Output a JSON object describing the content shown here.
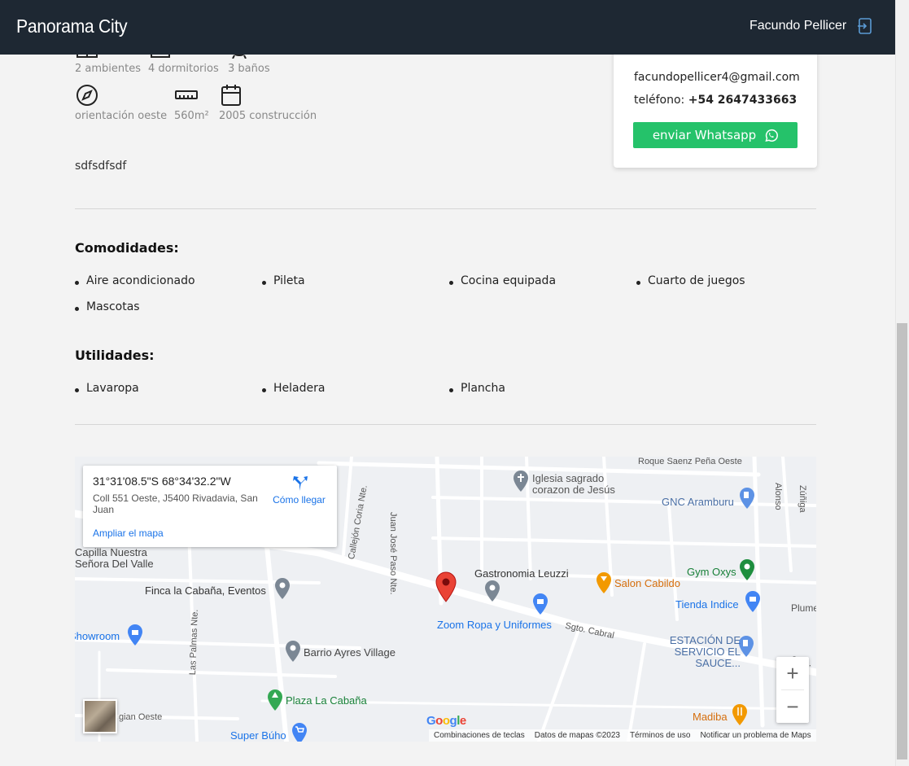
{
  "header": {
    "brand": "Panorama City",
    "user_name": "Facundo Pellicer"
  },
  "features": [
    {
      "icon": "rooms-icon",
      "label": "2 ambientes"
    },
    {
      "icon": "bed-icon",
      "label": "4 dormitorios"
    },
    {
      "icon": "bath-icon",
      "label": "3 baños"
    },
    {
      "icon": "compass-icon",
      "label": "orientación oeste"
    },
    {
      "icon": "ruler-icon",
      "label": "560m²"
    },
    {
      "icon": "calendar-icon",
      "label": "2005 construcción"
    }
  ],
  "description": "sdfsdfsdf",
  "contact": {
    "email": "facundopellicer4@gmail.com",
    "phone_label": "teléfono:",
    "phone": "+54 2647433663",
    "whatsapp_button": "enviar Whatsapp"
  },
  "amenities": {
    "title": "Comodidades:",
    "items": [
      "Aire acondicionado",
      "Pileta",
      "Cocina equipada",
      "Cuarto de juegos",
      "Mascotas"
    ]
  },
  "utilities": {
    "title": "Utilidades:",
    "items": [
      "Lavaropa",
      "Heladera",
      "Plancha"
    ]
  },
  "map": {
    "info": {
      "coords": "31°31'08.5\"S 68°34'32.2\"W",
      "address": "Coll 551 Oeste, J5400 Rivadavia, San Juan",
      "directions": "Cómo llegar",
      "expand": "Ampliar el mapa"
    },
    "places": {
      "iglesia": "Iglesia sagrado corazon de Jesús",
      "gnc": "GNC Aramburu",
      "gastronomia": "Gastronomia Leuzzi",
      "gym": "Gym Oxys",
      "salon": "Salon Cabildo",
      "tienda": "Tienda Indice",
      "zoom_ropa": "Zoom Ropa y Uniformes",
      "estacion": "ESTACIÓN DE SERVICIO EL SAUCE...",
      "finca": "Finca la Cabaña, Eventos",
      "capilla": "Capilla Nuestra Señora Del Valle",
      "showroom": "Showroom",
      "barrio": "Barrio Ayres Village",
      "plaza": "Plaza La Cabaña",
      "super_buho": "Super Búho",
      "madiba": "Madiba",
      "plume": "Plume"
    },
    "streets": {
      "roque": "Roque Saenz Peña Oeste",
      "juan_jose": "Juan José Paso Nte.",
      "callejon": "Callejón Coria Nte.",
      "las_palmas": "Las Palmas Nte.",
      "alonso": "Alonso",
      "zuniga": "Zúñiga",
      "sgto": "Sgto. Cabral",
      "gian": "gian Oeste",
      "cabral_right": "Sgto."
    },
    "zoom_in": "+",
    "zoom_out": "−",
    "google": "Google",
    "attribution": [
      "Combinaciones de teclas",
      "Datos de mapas ©2023",
      "Términos de uso",
      "Notificar un problema de Maps"
    ]
  }
}
